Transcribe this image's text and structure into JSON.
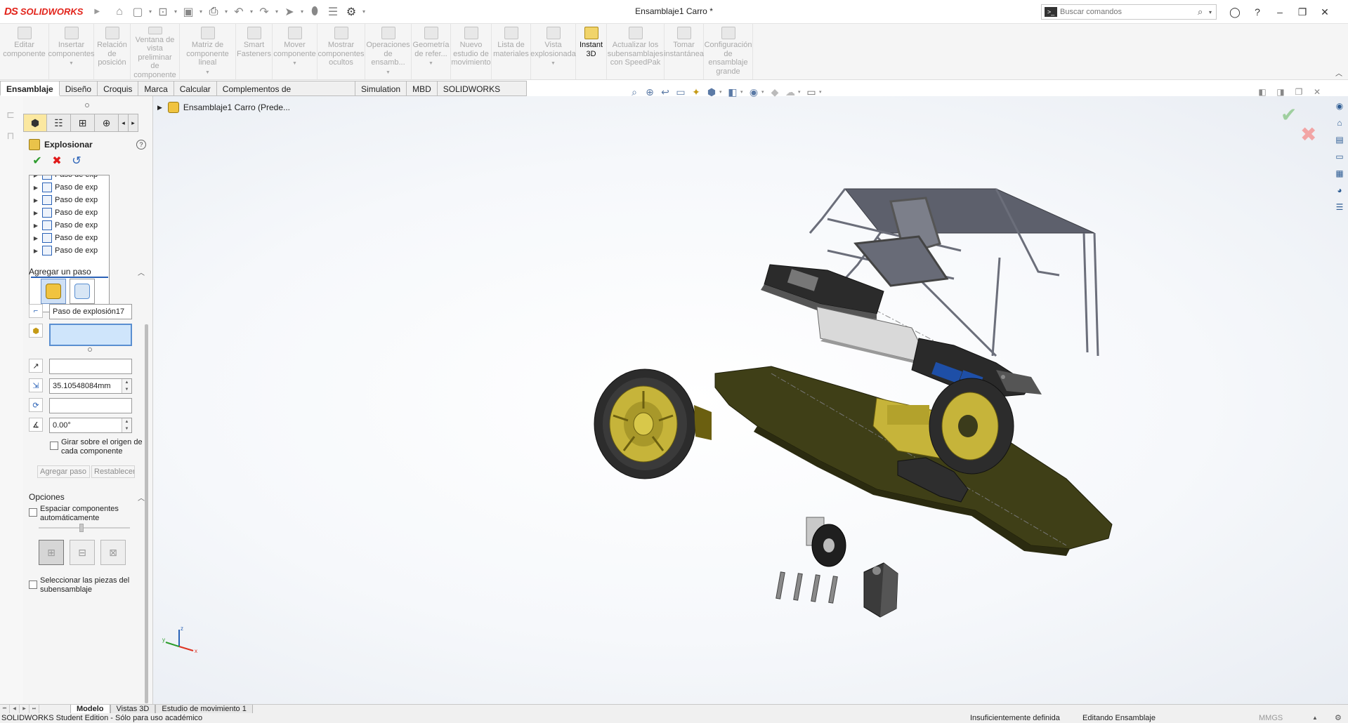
{
  "app": {
    "logo_ds": "DS",
    "logo_name": "SOLIDWORKS",
    "document_title": "Ensamblaje1 Carro *"
  },
  "search": {
    "placeholder": "Buscar comandos"
  },
  "ribbon": {
    "items": [
      {
        "label": "Editar componente",
        "w": 70
      },
      {
        "label": "Insertar componentes",
        "w": 64,
        "arrow": true
      },
      {
        "label": "Relación de posición",
        "w": 52
      },
      {
        "label": "Ventana de vista preliminar de componente",
        "w": 70
      },
      {
        "label": "Matriz de componente lineal",
        "w": 80,
        "arrow": true
      },
      {
        "label": "Smart Fasteners",
        "w": 52
      },
      {
        "label": "Mover componente",
        "w": 64,
        "arrow": true
      },
      {
        "label": "Mostrar componentes ocultos",
        "w": 68
      },
      {
        "label": "Operaciones de ensamb...",
        "w": 66,
        "arrow": true
      },
      {
        "label": "Geometría de refer...",
        "w": 56,
        "arrow": true
      },
      {
        "label": "Nuevo estudio de movimiento",
        "w": 58
      },
      {
        "label": "Lista de materiales",
        "w": 56
      },
      {
        "label": "Vista explosionada",
        "w": 64,
        "arrow": true
      },
      {
        "label": "Instant 3D",
        "w": 44,
        "active": true
      },
      {
        "label": "Actualizar los subensamblajes con SpeedPak",
        "w": 82
      },
      {
        "label": "Tomar instantánea",
        "w": 56
      },
      {
        "label": "Configuración de ensamblaje grande",
        "w": 70
      }
    ]
  },
  "command_tabs": [
    "Ensamblaje",
    "Diseño",
    "Croquis",
    "Marca",
    "Calcular",
    "Complementos de SOLIDWORKS",
    "Simulation",
    "MBD",
    "SOLIDWORKS CAM"
  ],
  "property_manager": {
    "title": "Explosionar",
    "help": "?",
    "steps": [
      "Paso de exp",
      "Paso de exp",
      "Paso de exp",
      "Paso de exp",
      "Paso de exp",
      "Paso de exp",
      "Paso de exp"
    ],
    "add_step_section": "Agregar un paso",
    "step_name": "Paso de explosión17",
    "distance": "35.10548084mm",
    "angle": "0.00°",
    "rotate_origin_label": "Girar sobre el origen de cada componente",
    "add_step_button": "Agregar paso",
    "reset_button": "Restablecer",
    "options_section": "Opciones",
    "auto_space_label": "Espaciar componentes automáticamente",
    "select_subassembly_label": "Seleccionar las piezas del subensamblaje"
  },
  "tree": {
    "root_label": "Ensamblaje1 Carro (Prede..."
  },
  "bottom_tabs": [
    "Modelo",
    "Vistas 3D",
    "Estudio de movimiento 1"
  ],
  "status": {
    "edition": "SOLIDWORKS Student Edition - Sólo para uso académico",
    "definition": "Insuficientemente definida",
    "mode": "Editando Ensamblaje",
    "units": "MMGS"
  },
  "colors": {
    "accent": "#2a62b7",
    "logo_red": "#e2231a",
    "chassis": "#3f3f17",
    "wheel_rim": "#c6b43a",
    "frame": "#6b6e7a"
  },
  "triad": {
    "x": "x",
    "y": "y",
    "z": "z"
  }
}
